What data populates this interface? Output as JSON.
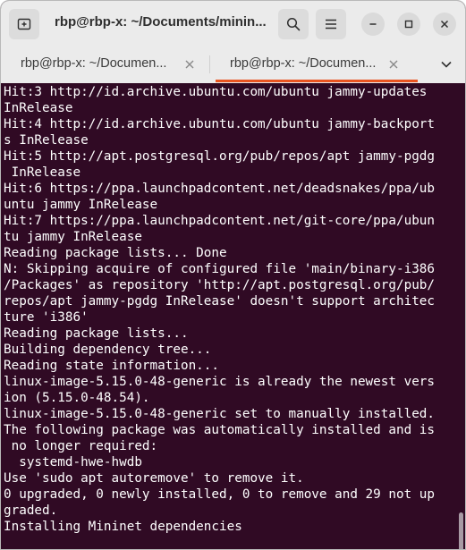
{
  "window": {
    "title": "rbp@rbp-x: ~/Documents/minin..."
  },
  "tabs": [
    {
      "label": "rbp@rbp-x: ~/Documen...",
      "active": false
    },
    {
      "label": "rbp@rbp-x: ~/Documen...",
      "active": true
    }
  ],
  "icons": {
    "new_tab": "new-tab-icon",
    "search": "search-icon",
    "menu": "hamburger-menu-icon",
    "minimize": "minimize-icon",
    "maximize": "maximize-icon",
    "close": "close-icon",
    "tab_close": "close-icon",
    "tab_list": "chevron-down-icon"
  },
  "colors": {
    "terminal_background": "#300a24",
    "terminal_text": "#ffffff",
    "active_tab_accent": "#e95420",
    "header_background": "#ebebeb"
  },
  "terminal": {
    "lines": [
      "Hit:3 http://id.archive.ubuntu.com/ubuntu jammy-updates",
      "InRelease",
      "Hit:4 http://id.archive.ubuntu.com/ubuntu jammy-backport",
      "s InRelease",
      "Hit:5 http://apt.postgresql.org/pub/repos/apt jammy-pgdg",
      " InRelease",
      "Hit:6 https://ppa.launchpadcontent.net/deadsnakes/ppa/ub",
      "untu jammy InRelease",
      "Hit:7 https://ppa.launchpadcontent.net/git-core/ppa/ubun",
      "tu jammy InRelease",
      "Reading package lists... Done",
      "N: Skipping acquire of configured file 'main/binary-i386",
      "/Packages' as repository 'http://apt.postgresql.org/pub/",
      "repos/apt jammy-pgdg InRelease' doesn't support architec",
      "ture 'i386'",
      "Reading package lists...",
      "Building dependency tree...",
      "Reading state information...",
      "linux-image-5.15.0-48-generic is already the newest vers",
      "ion (5.15.0-48.54).",
      "linux-image-5.15.0-48-generic set to manually installed.",
      "The following package was automatically installed and is",
      " no longer required:",
      "  systemd-hwe-hwdb",
      "Use 'sudo apt autoremove' to remove it.",
      "0 upgraded, 0 newly installed, 0 to remove and 29 not up",
      "graded.",
      "Installing Mininet dependencies"
    ]
  }
}
